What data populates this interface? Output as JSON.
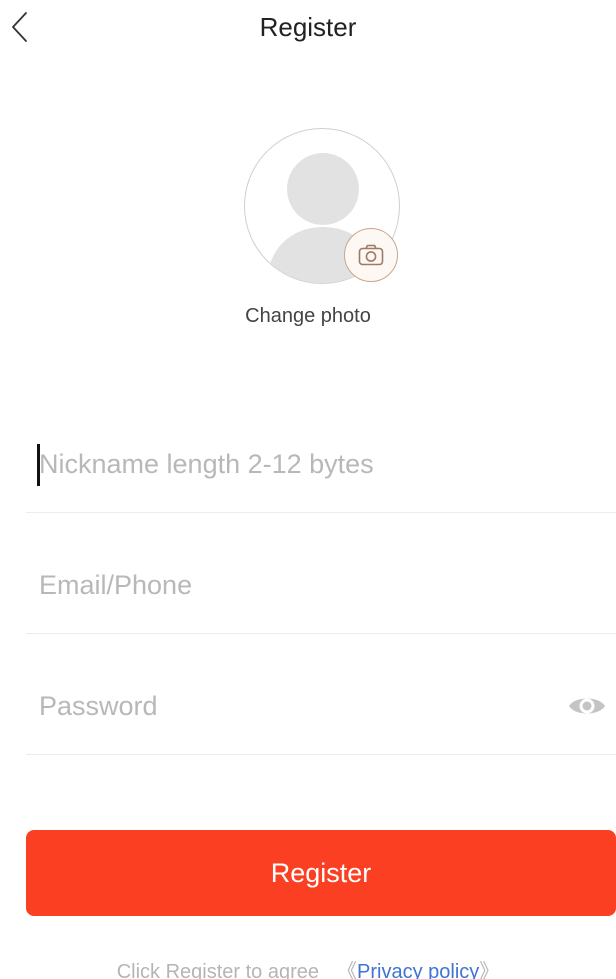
{
  "header": {
    "title": "Register",
    "back_icon": "chevron-left-icon"
  },
  "avatar": {
    "icon": "default-avatar-icon",
    "badge_icon": "camera-icon",
    "change_photo_label": "Change photo"
  },
  "form": {
    "nickname": {
      "placeholder": "Nickname length 2-12 bytes",
      "value": ""
    },
    "email": {
      "placeholder": "Email/Phone",
      "value": ""
    },
    "password": {
      "placeholder": "Password",
      "value": "",
      "toggle_icon": "eye-icon"
    }
  },
  "register_button": {
    "label": "Register"
  },
  "agreement": {
    "text": "Click Register to agree",
    "open_bracket": "《",
    "link_text": "Privacy policy",
    "close_bracket": "》"
  },
  "colors": {
    "accent": "#fb3f22",
    "link": "#3d74d6",
    "placeholder": "#b8b8b8",
    "badge_border": "#c9a58b"
  }
}
